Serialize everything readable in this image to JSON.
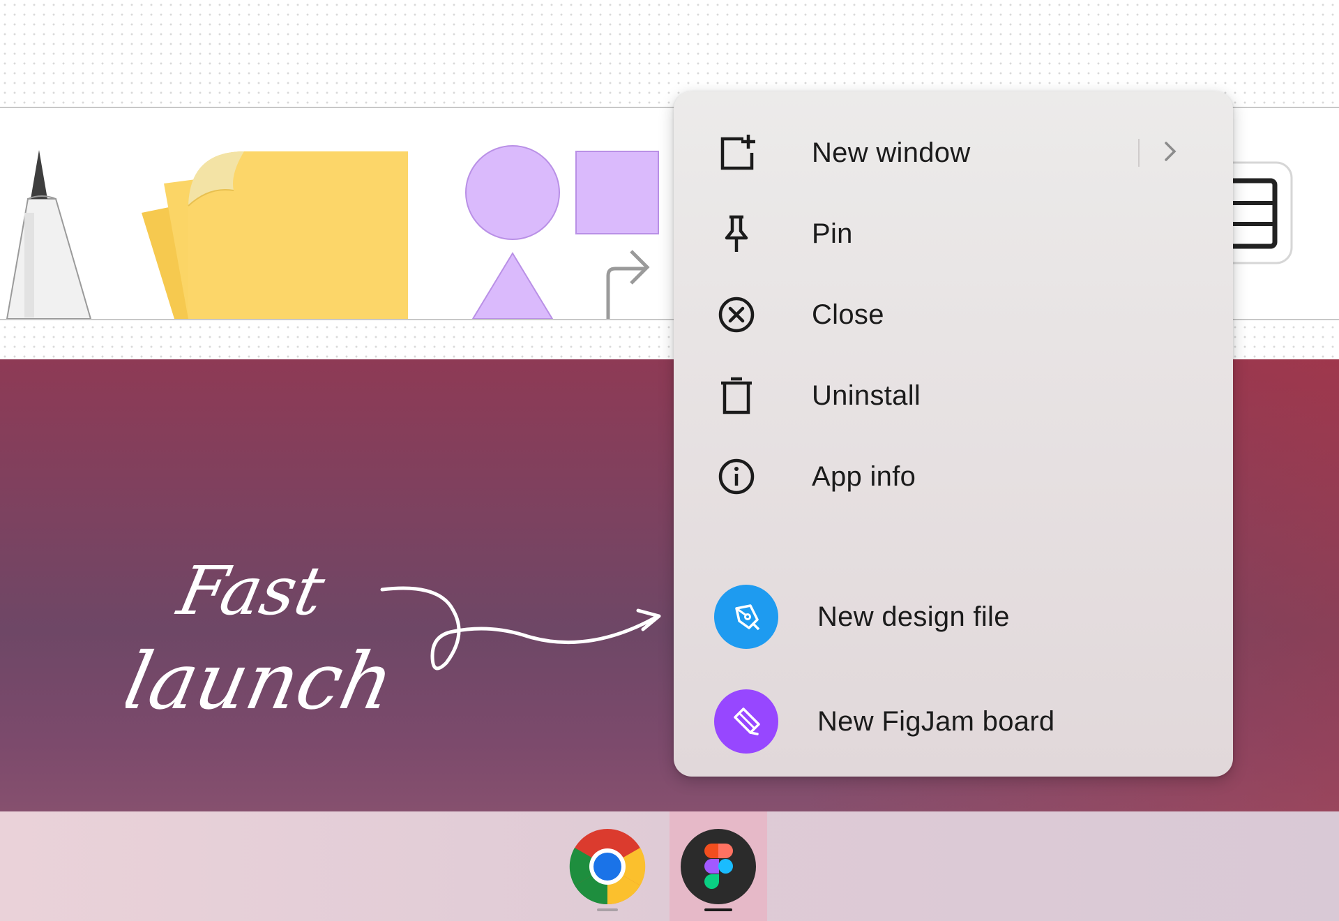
{
  "context_menu": {
    "items": [
      {
        "label": "New window",
        "icon": "new-window-icon",
        "has_submenu": true
      },
      {
        "label": "Pin",
        "icon": "pin-icon"
      },
      {
        "label": "Close",
        "icon": "close-icon"
      },
      {
        "label": "Uninstall",
        "icon": "trash-icon"
      },
      {
        "label": "App info",
        "icon": "info-icon"
      }
    ],
    "shortcuts": [
      {
        "label": "New design file",
        "icon": "pen-tool-icon",
        "color": "#1e9bf0"
      },
      {
        "label": "New FigJam board",
        "icon": "marker-icon",
        "color": "#9747ff"
      }
    ]
  },
  "wallpaper_text": {
    "line1": "Fast",
    "line2": "launch"
  },
  "shelf": {
    "apps": [
      {
        "name": "Chrome",
        "icon": "chrome-icon"
      },
      {
        "name": "Figma",
        "icon": "figma-icon",
        "active": true
      }
    ]
  },
  "colors": {
    "sticky_note": "#fcd669",
    "shape_fill": "#dabafc",
    "menu_background": "#e9e4e5",
    "figma_blue": "#1e9bf0",
    "figjam_purple": "#9747ff"
  }
}
